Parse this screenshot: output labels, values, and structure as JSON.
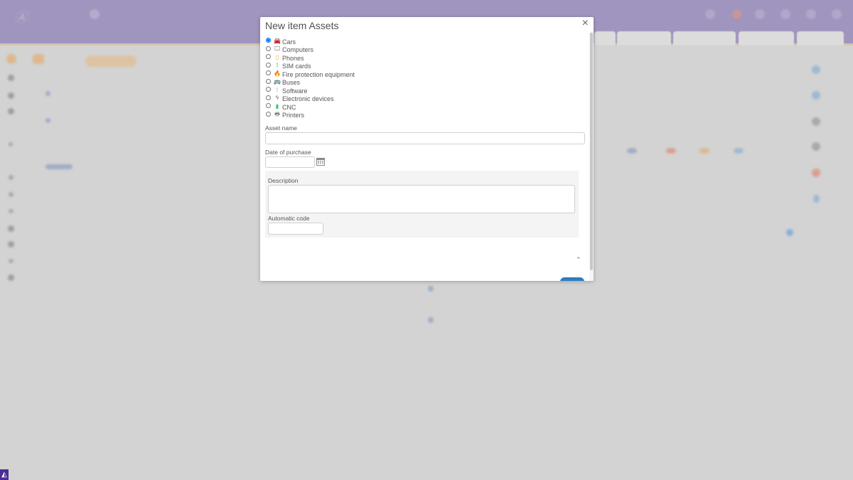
{
  "modal": {
    "title": "New item Assets",
    "close_glyph": "×",
    "asset_types": [
      {
        "label": "Cars",
        "icon": "car-icon",
        "glyph": "🚘",
        "color": "#555555",
        "selected": true
      },
      {
        "label": "Computers",
        "icon": "monitor-icon",
        "glyph": "🖵",
        "color": "#555555",
        "selected": false
      },
      {
        "label": "Phones",
        "icon": "phone-icon",
        "glyph": "▯",
        "color": "#f39c12",
        "selected": false
      },
      {
        "label": "SIM cards",
        "icon": "signal-icon",
        "glyph": "⟟",
        "color": "#27ae60",
        "selected": false
      },
      {
        "label": "Fire protection equipment",
        "icon": "fire-icon",
        "glyph": "🔥",
        "color": "#e74c3c",
        "selected": false
      },
      {
        "label": "Buses",
        "icon": "bus-icon",
        "glyph": "🚌",
        "color": "#27ae60",
        "selected": false
      },
      {
        "label": "Software",
        "icon": "antenna-icon",
        "glyph": "⟟",
        "color": "#8ab4d8",
        "selected": false
      },
      {
        "label": "Electronic devices",
        "icon": "bolt-icon",
        "glyph": "ϟ",
        "color": "#555555",
        "selected": false
      },
      {
        "label": "CNC",
        "icon": "cnc-icon",
        "glyph": "▮",
        "color": "#2ecc71",
        "selected": false
      },
      {
        "label": "Printers",
        "icon": "printer-icon",
        "glyph": "🖶",
        "color": "#777777",
        "selected": false
      }
    ],
    "asset_name": {
      "label": "Asset name",
      "value": "",
      "placeholder": ""
    },
    "date_of_purchase": {
      "label": "Date of purchase",
      "value": "",
      "placeholder": ""
    },
    "description": {
      "label": "Description",
      "value": ""
    },
    "automatic_code": {
      "label": "Automatic code",
      "value": ""
    }
  },
  "colors": {
    "header": "#8a7ab8",
    "accent": "#2f7cc0",
    "badge": "#4b2d97"
  }
}
